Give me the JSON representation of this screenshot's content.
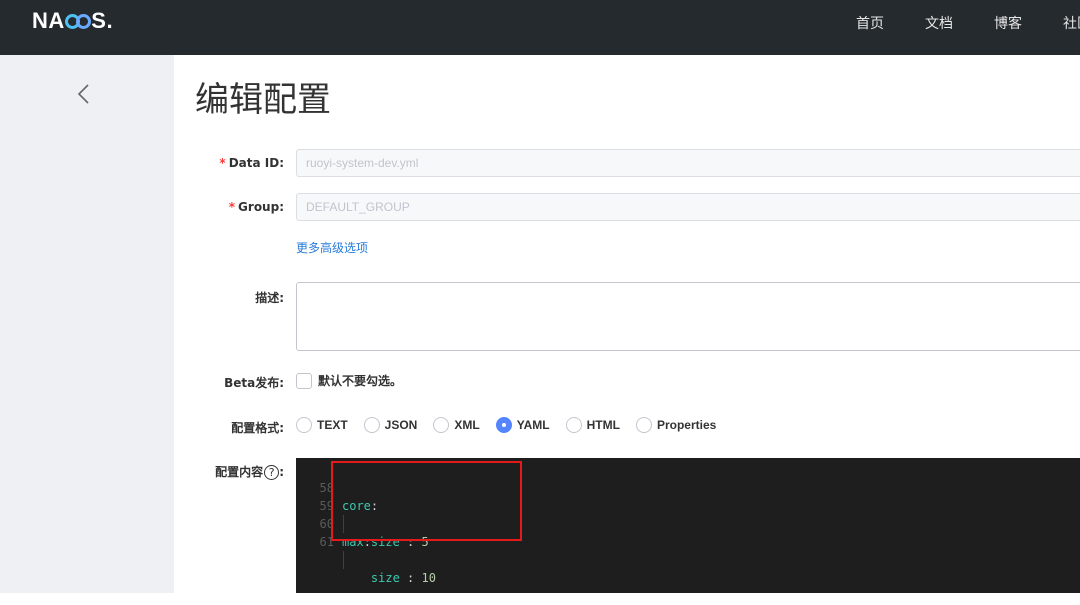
{
  "header": {
    "logo": "NACOS.",
    "nav": [
      "首页",
      "文档",
      "博客",
      "社区"
    ]
  },
  "page": {
    "title": "编辑配置"
  },
  "form": {
    "data_id": {
      "label": "Data ID:",
      "value": "ruoyi-system-dev.yml",
      "required": true
    },
    "group": {
      "label": "Group:",
      "value": "DEFAULT_GROUP",
      "required": true
    },
    "advanced_link": "更多高级选项",
    "description": {
      "label": "描述:",
      "value": ""
    },
    "beta": {
      "label": "Beta发布:",
      "checkbox_label": "默认不要勾选。"
    },
    "format": {
      "label": "配置格式:",
      "options": [
        "TEXT",
        "JSON",
        "XML",
        "YAML",
        "HTML",
        "Properties"
      ],
      "selected": "YAML"
    },
    "content": {
      "label": "配置内容",
      "help": "?",
      "label_suffix": ":",
      "lines": [
        {
          "num": "58",
          "indent": "",
          "key": "core",
          "sep": ":",
          "value": ""
        },
        {
          "num": "59",
          "indent": "    ",
          "key": "size",
          "sep": " : ",
          "value": "5"
        },
        {
          "num": "60",
          "indent": "",
          "key": "max",
          "sep": ":",
          "value": ""
        },
        {
          "num": "61",
          "indent": "    ",
          "key": "size",
          "sep": " : ",
          "value": "10"
        }
      ]
    }
  },
  "colors": {
    "topbar": "#252a2f",
    "sidebar": "#eef0f4",
    "editor_bg": "#1e1e1e",
    "accent": "#5584ff",
    "highlight": "#e51a1a"
  }
}
